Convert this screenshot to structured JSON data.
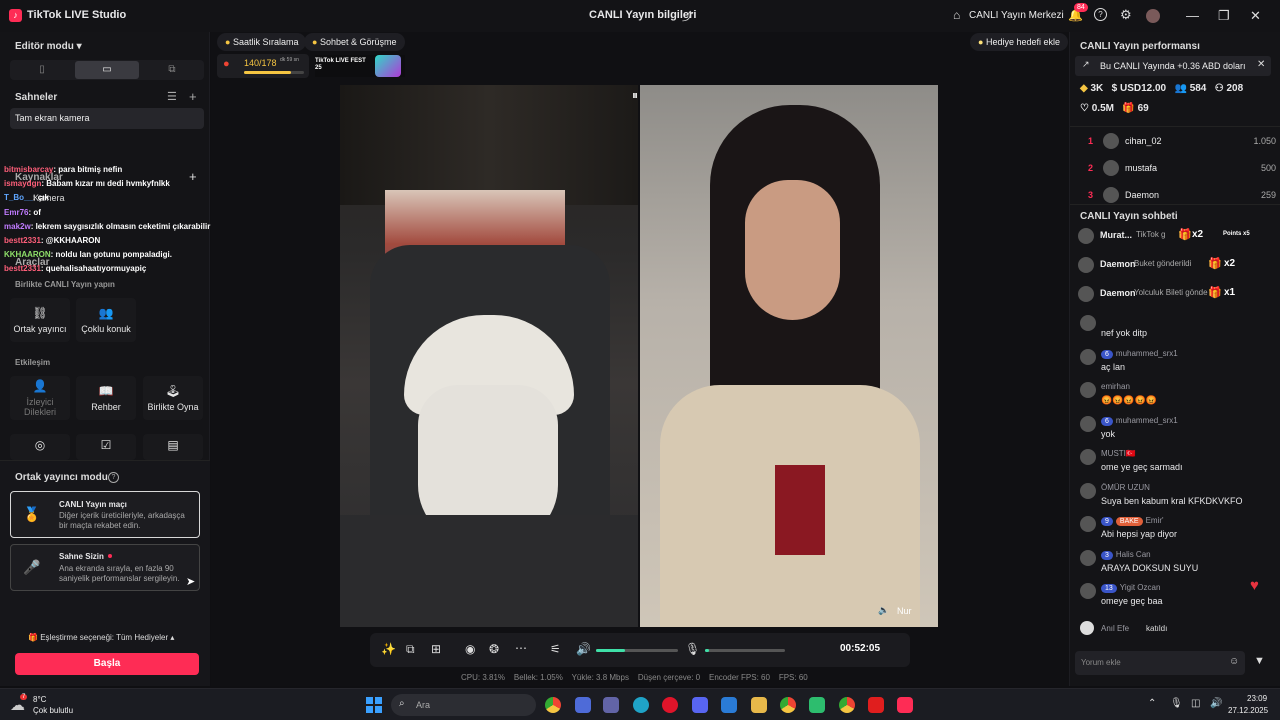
{
  "titlebar": {
    "app_title": "TikTok LIVE Studio",
    "center_title": "CANLI Yayın bilgileri",
    "live_center": "CANLI Yayın Merkezi",
    "notif_count": "84"
  },
  "left": {
    "editor_mode": "Editör modu",
    "scenes_label": "Sahneler",
    "scene_item": "Tam ekran kamera",
    "sources_label": "Kaynaklar",
    "source_camera": "Kamera",
    "tools_label": "Araçlar",
    "together_label": "Birlikte CANLI Yayın yapın",
    "tool_cohost": "Ortak yayıncı",
    "tool_multi": "Çoklu konuk",
    "interaction_label": "Etkileşim",
    "tool_viewer_requests": "İzleyici Dilekleri",
    "tool_guide": "Rehber",
    "tool_play": "Birlikte Oyna",
    "cohost_mode_label": "Ortak yayıncı modu",
    "match_title": "CANLI Yayın maçı",
    "match_desc": "Diğer içerik üreticileriyle, arkadaşça bir maçta rekabet edin.",
    "stage_title": "Sahne Sizin",
    "stage_desc": "Ana ekranda sırayla, en fazla 90 saniyelik performanslar sergileyin.",
    "match_option": "Eşleştirme seçeneği: Tüm Hediyeler",
    "start_button": "Başla"
  },
  "overlay_chat": [
    {
      "user": "bitmisbarcay",
      "msg": ": para bitmiş nefin",
      "color": "#ff5f7a"
    },
    {
      "user": "ismaydgn",
      "msg": ": Babam kızar mı dedi hvmkyfnlkk",
      "color": "#ff5f7a"
    },
    {
      "user": "T_Bo__",
      "msg": ": çık",
      "color": "#5fa6ff"
    },
    {
      "user": "Emr76",
      "msg": ": of",
      "color": "#c07bff"
    },
    {
      "user": "mak2w",
      "msg": ": lekrem saygısızlık olmasın ceketimi çıkarabilir miyim",
      "color": "#c07bff"
    },
    {
      "user": "bestt2331",
      "msg": ": @KKHAARON",
      "color": "#ff5f7a"
    },
    {
      "user": "KKHAARON",
      "msg": ": noldu lan gotunu pompaladigi.",
      "color": "#8fe06a"
    },
    {
      "user": "bestt2331",
      "msg": ": quehalisahaatıyormuyapiç",
      "color": "#ff5f7a"
    }
  ],
  "center": {
    "pill_hourly": "Saatlik Sıralama",
    "pill_chat": "Sohbet & Görüşme",
    "gift_goal": "Hediye hedefi ekle",
    "progress_text": "140/178",
    "progress_sub": "dk 59 sn",
    "progress_value": 0.79,
    "badge_fest": "TikTok LIVE FEST 25",
    "cohost_name": "Nur",
    "timer": "00:52:05",
    "volume_level": 0.35,
    "mic_level": 0.05
  },
  "stats": {
    "cpu": "CPU: 3.81%",
    "memory": "Bellek: 1.05%",
    "upload": "Yükle: 3.8 Mbps",
    "dropped": "Düşen çerçeve: 0",
    "encoder": "Encoder FPS: 60",
    "fps": "FPS: 60"
  },
  "right": {
    "perf_title": "CANLI Yayın performansı",
    "perf_banner": "Bu CANLI Yayında +0.36 ABD doları",
    "stat_likes": "3K",
    "stat_usd": "USD12.00",
    "stat_viewers": "584",
    "stat_followers": "208",
    "stat_hearts": "0.5M",
    "stat_gifts": "69",
    "ranking": [
      {
        "rank": "1",
        "name": "cihan_02",
        "score": "1.050"
      },
      {
        "rank": "2",
        "name": "mustafa",
        "score": "500"
      },
      {
        "rank": "3",
        "name": "Daemon",
        "score": "259"
      }
    ],
    "chat_title": "CANLI Yayın sohbeti",
    "gift_events": [
      {
        "name": "Murat...",
        "text": "TikTok g",
        "count": "x2",
        "extra": "Points x5"
      },
      {
        "name": "Daemon",
        "text": "Buket gönderildi",
        "count": "x2",
        "extra": ""
      },
      {
        "name": "Daemon",
        "text": "Yolculuk Bileti gönde",
        "count": "x1",
        "extra": ""
      }
    ],
    "messages": [
      {
        "user": "",
        "level": "",
        "msg": "nef yok ditp"
      },
      {
        "user": "muhammed_srx1",
        "level": "6",
        "msg": "aç lan"
      },
      {
        "user": "emirhan",
        "level": "",
        "msg": "😡😡😡😡😡"
      },
      {
        "user": "muhammed_srx1",
        "level": "6",
        "msg": "yok"
      },
      {
        "user": "MUSTI🇹🇷",
        "level": "",
        "msg": "ome ye geç sarmadı"
      },
      {
        "user": "ÖMÜR UZUN",
        "level": "",
        "msg": "Suya ben kabum kral KFKDKVKFO"
      },
      {
        "user": "Emir'",
        "level": "9",
        "msg": "Abi hepsi yap diyor"
      },
      {
        "user": "Halis Can",
        "level": "3",
        "msg": "ARAYA DOKSUN SUYU"
      },
      {
        "user": "Yigit Ozcan",
        "level": "13",
        "msg": "omeye geç baa"
      }
    ],
    "join_name": "Anıl Efe",
    "join_text": "katıldı",
    "comment_placeholder": "Yorum ekle",
    "bake_badge": "BAKE"
  },
  "taskbar": {
    "weather_temp": "8°C",
    "weather_desc": "Çok bulutlu",
    "search_placeholder": "Ara",
    "time": "23:09",
    "date": "27.12.2025",
    "weather_badge": "7"
  }
}
